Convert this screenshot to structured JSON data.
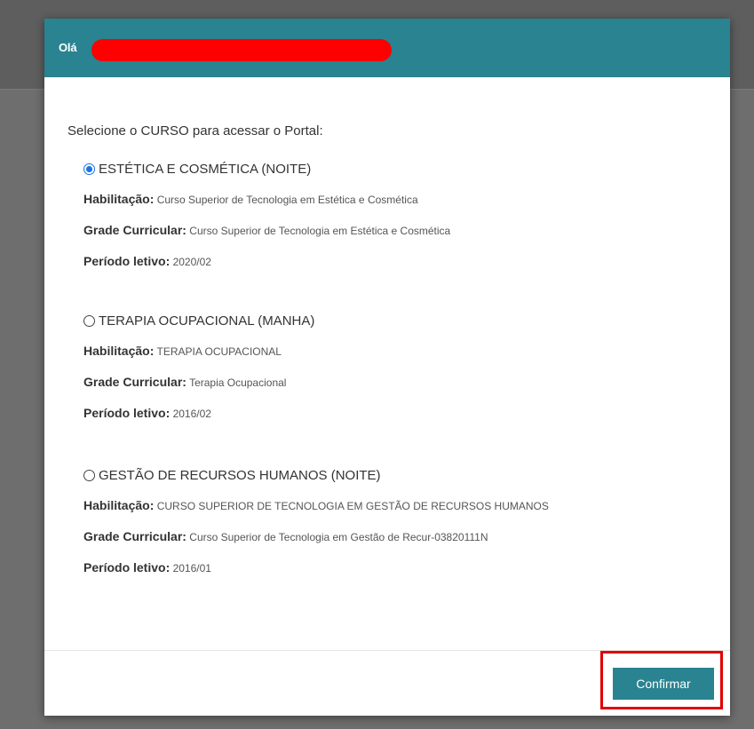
{
  "header": {
    "greeting": "Olá"
  },
  "prompt": "Selecione o CURSO para acessar o Portal:",
  "labels": {
    "habilitacao": "Habilitação:",
    "grade": "Grade Curricular:",
    "periodo": "Período letivo:"
  },
  "courses": [
    {
      "title": "ESTÉTICA E COSMÉTICA (NOITE)",
      "selected": true,
      "habilitacao": "Curso Superior de Tecnologia em Estética e Cosmética",
      "grade": "Curso Superior de Tecnologia em Estética e Cosmética",
      "periodo": "2020/02"
    },
    {
      "title": "TERAPIA OCUPACIONAL (MANHA)",
      "selected": false,
      "habilitacao": "TERAPIA OCUPACIONAL",
      "grade": "Terapia Ocupacional",
      "periodo": "2016/02"
    },
    {
      "title": "GESTÃO DE RECURSOS HUMANOS (NOITE)",
      "selected": false,
      "habilitacao": "CURSO SUPERIOR DE TECNOLOGIA EM GESTÃO DE RECURSOS HUMANOS",
      "grade": "Curso Superior de Tecnologia em Gestão de Recur-03820111N",
      "periodo": "2016/01"
    }
  ],
  "footer": {
    "confirm_label": "Confirmar"
  },
  "colors": {
    "header_bg": "#2a8390",
    "button_bg": "#2a8390",
    "highlight_border": "#e00000",
    "redaction": "#ff0000"
  }
}
